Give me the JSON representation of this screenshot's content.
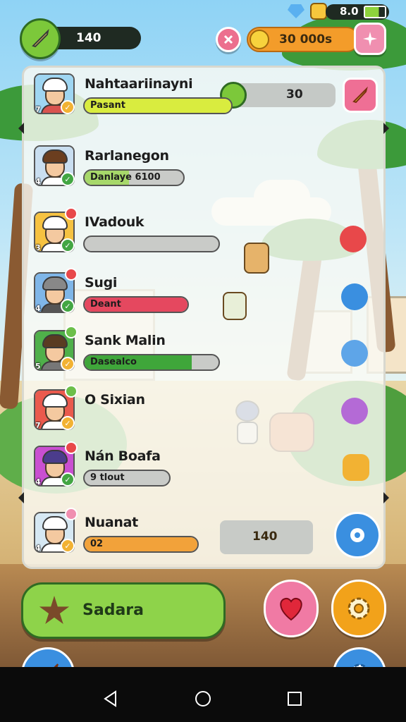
{
  "hud": {
    "xp_value": "140",
    "top_right_value": "8.0",
    "coins_value": "30 000s"
  },
  "players": [
    {
      "name": "Nahtaariinayni",
      "level": "7",
      "bar_text": "Pasant",
      "bar_color": "#d9ec3f",
      "bar_fill": 1.0,
      "avatar_bg": "#9fd6f2",
      "hair": "#ffffff",
      "body": "#d9534f",
      "status_color": "#f2b233",
      "flower": false
    },
    {
      "name": "Rarlanegon",
      "level": "4",
      "bar_text": "Danlaye 6100",
      "bar_color": "#a7d86a",
      "bar_fill": 0.45,
      "avatar_bg": "#c9def0",
      "hair": "#6b3e1f",
      "body": "#ffffff",
      "status_color": "#43a643",
      "flower": false
    },
    {
      "name": "IVadouk",
      "level": "3",
      "bar_text": "",
      "bar_color": "#c9cbc8",
      "bar_fill": 0.0,
      "avatar_bg": "#f6c241",
      "hair": "#ffffff",
      "body": "#ffffff",
      "status_color": "#43a643",
      "flower": true,
      "flower_color": "#e8484a"
    },
    {
      "name": "Sugi",
      "level": "4",
      "bar_text": "Deant",
      "bar_color": "#e5485f",
      "bar_fill": 1.0,
      "avatar_bg": "#7fb6e8",
      "hair": "#888888",
      "body": "#555555",
      "status_color": "#43a643",
      "flower": true,
      "flower_color": "#e8484a"
    },
    {
      "name": "Sank Malin",
      "level": "5",
      "bar_text": "Dasealco",
      "bar_color": "#3fa63a",
      "bar_fill": 0.8,
      "avatar_bg": "#4fb04a",
      "hair": "#5a3c22",
      "body": "#777777",
      "status_color": "#f2b233",
      "flower": true,
      "flower_color": "#6cbf4a"
    },
    {
      "name": "O Sixian",
      "level": "7",
      "bar_text": "",
      "bar_color": "#c9cbc8",
      "bar_fill": 0.0,
      "avatar_bg": "#ea5a4d",
      "hair": "#ffffff",
      "body": "#ffffff",
      "status_color": "#f2b233",
      "flower": true,
      "flower_color": "#6cbf4a"
    },
    {
      "name": "Nán Boafa",
      "level": "4",
      "bar_text": "9 tlout",
      "bar_color": "#c9cbc8",
      "bar_fill": 0.0,
      "avatar_bg": "#c94fd1",
      "hair": "#4b3c8c",
      "body": "#ffffff",
      "status_color": "#43a643",
      "flower": true,
      "flower_color": "#e8484a"
    },
    {
      "name": "Nuanat",
      "level": "4",
      "bar_text": "02",
      "bar_color": "#f2a23a",
      "bar_fill": 1.0,
      "avatar_bg": "#d6e8f3",
      "hair": "#ffffff",
      "body": "#ffffff",
      "status_color": "#f2b233",
      "flower": true,
      "flower_color": "#f08fb0"
    }
  ],
  "panel": {
    "top_score": "30",
    "bottom_score": "140"
  },
  "bottom": {
    "main_button_label": "Sadara"
  }
}
